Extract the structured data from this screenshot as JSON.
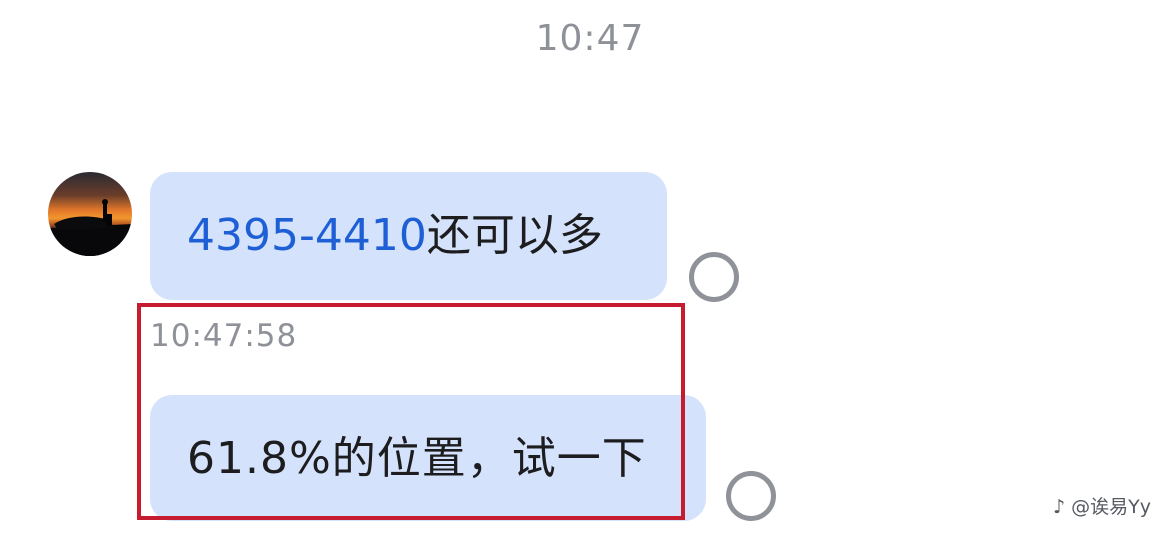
{
  "chat": {
    "time_divider": "10:47",
    "messages": [
      {
        "link_text": "4395-4410",
        "rest_text": "还可以多"
      },
      {
        "timestamp": "10:47:58",
        "text": "61.8%的位置，试一下"
      }
    ]
  },
  "watermark": {
    "text": "♪ @诶易Yy"
  },
  "colors": {
    "bubble": "#d4e3fb",
    "link": "#1f5fd6",
    "highlight": "#c51d2f",
    "meta_text": "#8e9298"
  }
}
